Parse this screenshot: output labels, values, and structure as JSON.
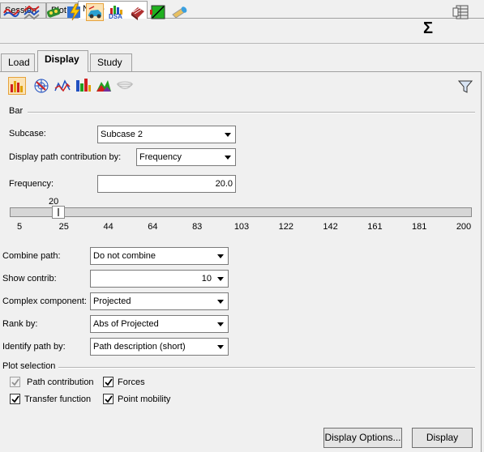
{
  "top_tabs": [
    {
      "label": "Session"
    },
    {
      "label": "Plot"
    },
    {
      "label": "NVH-Utilities",
      "close": "✕"
    }
  ],
  "toolbar": {
    "icons": [
      "curve-icon",
      "multi-curve-icon",
      "engine-icon",
      "lightning-icon",
      "car-icon",
      "dsa-icon",
      "block-icon",
      "green-square-icon",
      "cylinder-icon"
    ],
    "dsa_text": "DSA",
    "sigma": "Σ"
  },
  "sub_tabs": [
    {
      "label": "Load"
    },
    {
      "label": "Display"
    },
    {
      "label": "Study"
    }
  ],
  "plot_types": [
    "bar-chart-icon",
    "polar-icon",
    "line-icon",
    "colored-bar-icon",
    "waterfall-icon",
    "bowl-icon"
  ],
  "section": {
    "bar": "Bar",
    "plot_selection": "Plot selection"
  },
  "subcase": {
    "label": "Subcase:",
    "value": "Subcase 2"
  },
  "display_path": {
    "label": "Display path contribution by:",
    "value": "Frequency"
  },
  "frequency": {
    "label": "Frequency:",
    "value": "20.0"
  },
  "slider": {
    "current_label": "20",
    "min": 5,
    "max": 200,
    "value": 20,
    "ticks": [
      "5",
      "25",
      "44",
      "64",
      "83",
      "103",
      "122",
      "142",
      "161",
      "181",
      "200"
    ]
  },
  "combine_path": {
    "label": "Combine path:",
    "value": "Do not combine"
  },
  "show_contrib": {
    "label": "Show contrib:",
    "value": "10"
  },
  "complex_component": {
    "label": "Complex component:",
    "value": "Projected"
  },
  "rank_by": {
    "label": "Rank by:",
    "value": "Abs of Projected"
  },
  "identify_path": {
    "label": "Identify path by:",
    "value": "Path description (short)"
  },
  "checkboxes": {
    "path_contribution": {
      "label": "Path contribution",
      "checked": true,
      "disabled": true
    },
    "forces": {
      "label": "Forces",
      "checked": true
    },
    "transfer_function": {
      "label": "Transfer function",
      "checked": true
    },
    "point_mobility": {
      "label": "Point mobility",
      "checked": true
    }
  },
  "buttons": {
    "display_options": "Display Options...",
    "display": "Display"
  }
}
